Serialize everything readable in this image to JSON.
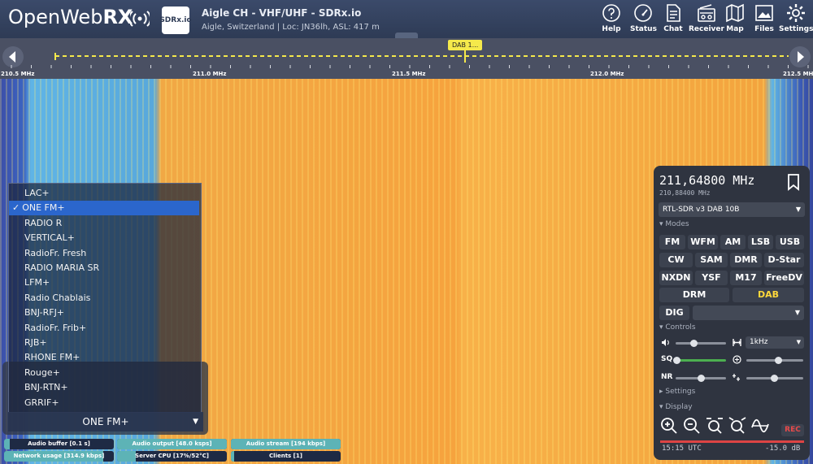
{
  "header": {
    "logo_thin": "OpenWeb",
    "logo_bold": "RX",
    "badge": "SDRx.io",
    "title": "Aigle CH - VHF/UHF - SDRx.io",
    "subtitle": "Aigle, Switzerland | Loc: JN36lh, ASL: 417 m",
    "nav": [
      {
        "label": "Help",
        "icon": "help-icon"
      },
      {
        "label": "Status",
        "icon": "gauge-icon"
      },
      {
        "label": "Chat",
        "icon": "chat-icon"
      },
      {
        "label": "Receiver",
        "icon": "radio-icon"
      },
      {
        "label": "Map",
        "icon": "map-icon"
      },
      {
        "label": "Files",
        "icon": "image-icon"
      },
      {
        "label": "Settings",
        "icon": "gear-icon"
      }
    ]
  },
  "scale": {
    "bookmark": "DAB 1...",
    "ticks": [
      "210.5 MHz",
      "211.0 MHz",
      "211.5 MHz",
      "212.0 MHz",
      "212.5 MHz"
    ]
  },
  "stations": {
    "selected_index": 1,
    "items": [
      "LAC+",
      "ONE FM+",
      "RADIO R",
      "VERTICAL+",
      "RadioFr. Fresh",
      "RADIO MARIA SR",
      "LFM+",
      "Radio Chablais",
      "BNJ-RFJ+",
      "RadioFr. Frib+",
      "RJB+",
      "RHONE FM+",
      "Rouge+",
      "BNJ-RTN+",
      "GRRIF+"
    ],
    "selected_label": "ONE FM+",
    "check": "✓"
  },
  "status": [
    {
      "label": "Audio buffer [0.1 s]",
      "level": 0.05
    },
    {
      "label": "Audio output [48.0 ksps]",
      "level": 1.0
    },
    {
      "label": "Audio stream [194 kbps]",
      "level": 1.0
    },
    {
      "label": "Network usage [314.9 kbps]",
      "level": 0.9
    },
    {
      "label": "Server CPU [17%/52°C]",
      "level": 0.17
    },
    {
      "label": "Clients [1]",
      "level": 0.03
    }
  ],
  "receiver": {
    "frequency": "211,64800 MHz",
    "center_frequency": "210,88400 MHz",
    "profile": "RTL-SDR v3 DAB 10B",
    "modes_header": "Modes",
    "modes_row1": [
      "FM",
      "WFM",
      "AM",
      "LSB",
      "USB"
    ],
    "modes_row2": [
      "CW",
      "SAM",
      "DMR",
      "D-Star"
    ],
    "modes_row3": [
      "NXDN",
      "YSF",
      "M17",
      "FreeDV"
    ],
    "modes_row4": [
      "DRM",
      "DAB"
    ],
    "active_mode": "DAB",
    "dig_label": "DIG",
    "controls_header": "Controls",
    "filter": "1kHz",
    "sq_label": "SQ",
    "nr_label": "NR",
    "volume_level": 0.35,
    "squelch_level": 0.55,
    "nr_level": 0.5,
    "settings_header": "Settings",
    "display_header": "Display",
    "rec_label": "REC",
    "time": "15:15 UTC",
    "db": "-15.0 dB"
  },
  "colors": {
    "accent": "#ffd83b",
    "selected": "#2b66cc",
    "header": "#34425f"
  }
}
